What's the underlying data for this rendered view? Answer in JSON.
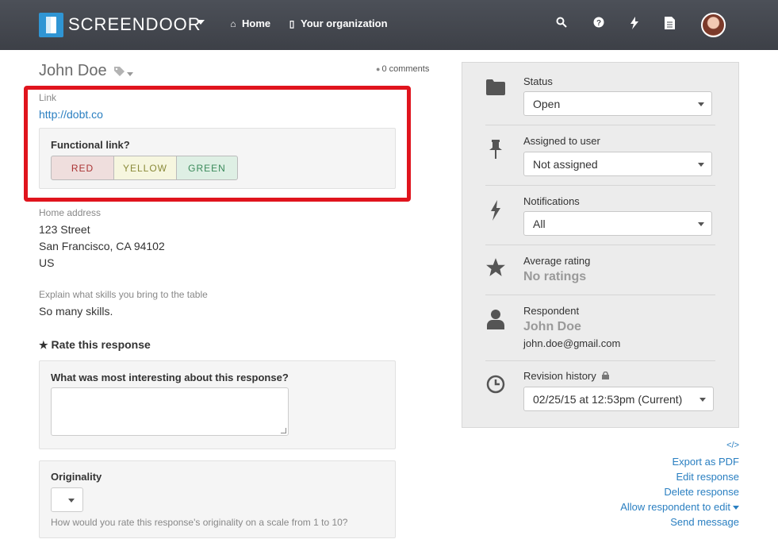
{
  "nav": {
    "brand": "SCREENDOOR",
    "links": [
      {
        "label": "Home",
        "icon": "home-icon"
      },
      {
        "label": "Your organization",
        "icon": "building-icon"
      }
    ],
    "icons": [
      "search-icon",
      "help-icon",
      "lightning-icon",
      "document-icon"
    ]
  },
  "response": {
    "name": "John Doe",
    "comments": "0 comments",
    "link_label": "Link",
    "link_value": "http://dobt.co",
    "functional_title": "Functional link?",
    "rating_buttons": [
      "RED",
      "YELLOW",
      "GREEN"
    ],
    "address_label": "Home address",
    "address_lines": [
      "123 Street",
      "San Francisco, CA 94102",
      "US"
    ],
    "skills_label": "Explain what skills you bring to the table",
    "skills_value": "So many skills.",
    "rate_heading": "Rate this response",
    "q1_title": "What was most interesting about this response?",
    "q2_title": "Originality",
    "q2_help": "How would you rate this response's originality on a scale from 1 to 10?"
  },
  "sidebar": {
    "status_label": "Status",
    "status_value": "Open",
    "assigned_label": "Assigned to user",
    "assigned_value": "Not assigned",
    "notifications_label": "Notifications",
    "notifications_value": "All",
    "rating_label": "Average rating",
    "rating_value": "No ratings",
    "respondent_label": "Respondent",
    "respondent_name": "John Doe",
    "respondent_email": "john.doe@gmail.com",
    "revision_label": "Revision history",
    "revision_value": "02/25/15 at 12:53pm (Current)"
  },
  "actions": {
    "embed": "</>",
    "export": "Export as PDF",
    "edit": "Edit response",
    "delete": "Delete response",
    "allow_edit": "Allow respondent to edit",
    "send": "Send message"
  },
  "colors": {
    "highlight": "#e0141d",
    "link": "#2a7fc1",
    "nav_bg": "#45484f",
    "brand_blue": "#2f95d4"
  }
}
